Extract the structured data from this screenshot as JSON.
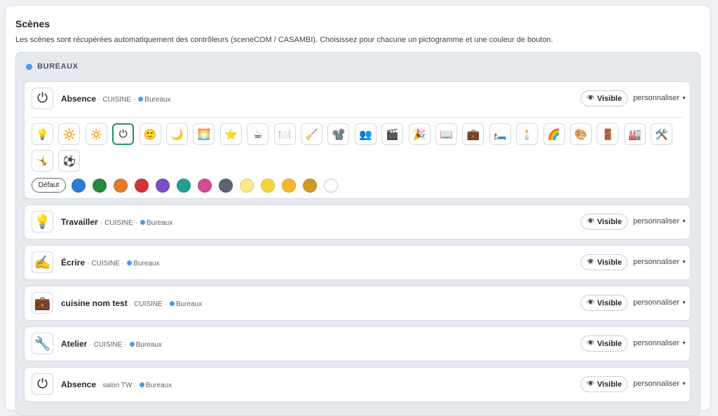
{
  "header": {
    "title": "Scènes",
    "description": "Les scènes sont récupérées automatiquement des contrôleurs (sceneCOM / CASAMBI). Choisissez pour chacune un pictogramme et une couleur de bouton."
  },
  "group": {
    "name": "BUREAUX",
    "color": "#4a9be8"
  },
  "scenes": [
    {
      "name": "Absence",
      "room": "CUISINE",
      "location": "Bureaux",
      "icon": "power-icon",
      "glyph": "⏻",
      "visible_label": "Visible",
      "customize_label": "personnaliser"
    },
    {
      "name": "Travailler",
      "room": "CUISINE",
      "location": "Bureaux",
      "icon": "lightbulb-icon",
      "glyph": "💡",
      "visible_label": "Visible",
      "customize_label": "personnaliser"
    },
    {
      "name": "Écrire",
      "room": "CUISINE",
      "location": "Bureaux",
      "icon": "writing-hand-icon",
      "glyph": "✍️",
      "visible_label": "Visible",
      "customize_label": "personnaliser"
    },
    {
      "name": "cuisine nom test",
      "room": "CUISINE",
      "location": "Bureaux",
      "icon": "briefcase-icon",
      "glyph": "💼",
      "visible_label": "Visible",
      "customize_label": "personnaliser"
    },
    {
      "name": "Atelier",
      "room": "CUISINE",
      "location": "Bureaux",
      "icon": "wrench-icon",
      "glyph": "🔧",
      "visible_label": "Visible",
      "customize_label": "personnaliser"
    },
    {
      "name": "Absence",
      "room": "salon TW",
      "location": "Bureaux",
      "icon": "power-icon",
      "glyph": "⏻",
      "visible_label": "Visible",
      "customize_label": "personnaliser"
    }
  ],
  "icon_picker": [
    {
      "name": "lightbulb-icon",
      "glyph": "💡"
    },
    {
      "name": "sun-icon",
      "glyph": "🔆"
    },
    {
      "name": "dim-sun-icon",
      "glyph": "🔅"
    },
    {
      "name": "power-icon",
      "glyph": "⏻",
      "selected": true
    },
    {
      "name": "smiley-icon",
      "glyph": "🙂"
    },
    {
      "name": "moon-icon",
      "glyph": "🌙"
    },
    {
      "name": "sunset-icon",
      "glyph": "🌅"
    },
    {
      "name": "star-icon",
      "glyph": "⭐"
    },
    {
      "name": "coffee-icon",
      "glyph": "☕"
    },
    {
      "name": "plate-icon",
      "glyph": "🍽️"
    },
    {
      "name": "broom-icon",
      "glyph": "🧹"
    },
    {
      "name": "projector-icon",
      "glyph": "📽️"
    },
    {
      "name": "people-icon",
      "glyph": "👥"
    },
    {
      "name": "clapper-icon",
      "glyph": "🎬"
    },
    {
      "name": "party-icon",
      "glyph": "🎉"
    },
    {
      "name": "book-icon",
      "glyph": "📖"
    },
    {
      "name": "briefcase-icon",
      "glyph": "💼"
    },
    {
      "name": "bed-icon",
      "glyph": "🛏️"
    },
    {
      "name": "candle-icon",
      "glyph": "🕯️"
    },
    {
      "name": "rainbow-icon",
      "glyph": "🌈"
    },
    {
      "name": "palette-icon",
      "glyph": "🎨"
    },
    {
      "name": "door-icon",
      "glyph": "🚪"
    },
    {
      "name": "factory-icon",
      "glyph": "🏭"
    },
    {
      "name": "tools-icon",
      "glyph": "🛠️"
    },
    {
      "name": "dancer-icon",
      "glyph": "🤸"
    },
    {
      "name": "soccer-ball-icon",
      "glyph": "⚽"
    }
  ],
  "colors": {
    "default_label": "Défaut",
    "swatches": [
      {
        "name": "blue",
        "hex": "#2e7bd2"
      },
      {
        "name": "green",
        "hex": "#25893f"
      },
      {
        "name": "orange",
        "hex": "#e07b26"
      },
      {
        "name": "red",
        "hex": "#d3343a"
      },
      {
        "name": "purple",
        "hex": "#7a4fc8"
      },
      {
        "name": "teal",
        "hex": "#24a092"
      },
      {
        "name": "pink",
        "hex": "#d04d94"
      },
      {
        "name": "slate",
        "hex": "#5b6472"
      },
      {
        "name": "pale-yellow",
        "hex": "#fbe989"
      },
      {
        "name": "yellow",
        "hex": "#f8d53e"
      },
      {
        "name": "amber",
        "hex": "#f4b62c"
      },
      {
        "name": "gold",
        "hex": "#cf9a24"
      },
      {
        "name": "white",
        "hex": "#ffffff"
      }
    ]
  }
}
